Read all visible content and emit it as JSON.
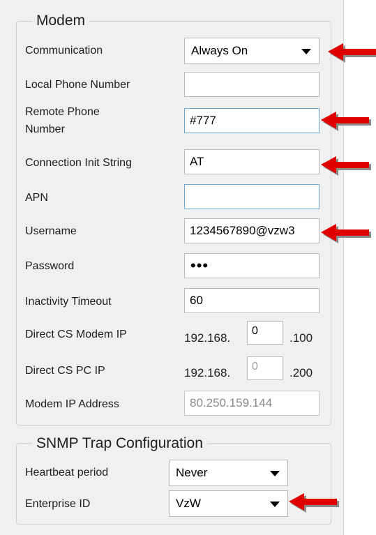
{
  "modem": {
    "title": "Modem",
    "communication": {
      "label": "Communication",
      "value": "Always On"
    },
    "local_phone": {
      "label": "Local Phone Number",
      "value": ""
    },
    "remote_phone": {
      "label_line1": "Remote Phone",
      "label_line2": "Number",
      "value": "#777"
    },
    "init_string": {
      "label": "Connection Init String",
      "value": "AT"
    },
    "apn": {
      "label": "APN",
      "value": ""
    },
    "username": {
      "label": "Username",
      "value": "1234567890@vzw3"
    },
    "password": {
      "label": "Password",
      "value": "•••"
    },
    "inactivity": {
      "label": "Inactivity Timeout",
      "value": "60"
    },
    "direct_cs_modem_ip": {
      "label": "Direct CS Modem IP",
      "prefix": "192.168.",
      "octet": "0",
      "suffix": ".100"
    },
    "direct_cs_pc_ip": {
      "label": "Direct CS PC IP",
      "prefix": "192.168.",
      "octet": "0",
      "suffix": ".200"
    },
    "modem_ip": {
      "label": "Modem IP Address",
      "value": "80.250.159.144"
    }
  },
  "snmp": {
    "title": "SNMP Trap Configuration",
    "heartbeat": {
      "label": "Heartbeat period",
      "value": "Never"
    },
    "enterprise_id": {
      "label": "Enterprise ID",
      "value": "VzW"
    }
  },
  "colors": {
    "panel_bg": "#f0f0f0",
    "annotation_arrow": "#e00000",
    "focus_border": "#6aa8d8"
  }
}
